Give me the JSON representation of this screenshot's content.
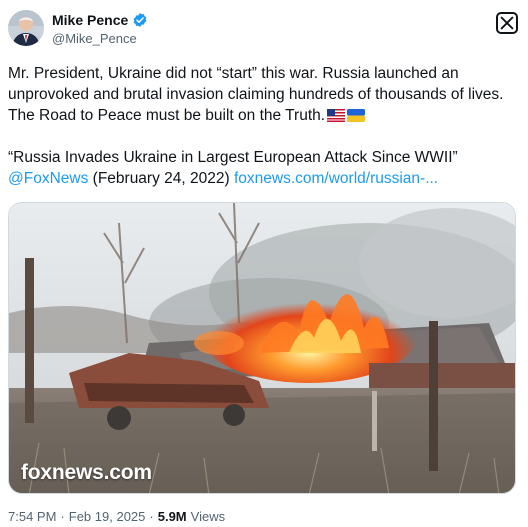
{
  "author": {
    "name": "Mike Pence",
    "handle": "@Mike_Pence"
  },
  "icons": {
    "verified": "verified-badge-icon",
    "platform_logo": "x-logo-icon"
  },
  "colors": {
    "link": "#1d9bf0",
    "verified": "#1d9bf0",
    "secondary_text": "#536471"
  },
  "tweet": {
    "line1": "Mr. President, Ukraine did not “start” this war. Russia launched an",
    "line2": "unprovoked and brutal invasion claiming hundreds of thousands of lives.",
    "line3": "The Road to Peace must be built on the Truth.",
    "quote_line": "“Russia Invades Ukraine in Largest European Attack Since WWII”",
    "mention": "@FoxNews",
    "date_text": "(February 24, 2022)",
    "link_text": "foxnews.com/world/russian-..."
  },
  "media": {
    "watermark": "foxnews.com"
  },
  "footer": {
    "time": "7:54 PM",
    "sep1": "·",
    "date": "Feb 19, 2025",
    "sep2": "·",
    "views_count": "5.9M",
    "views_label": "Views"
  }
}
